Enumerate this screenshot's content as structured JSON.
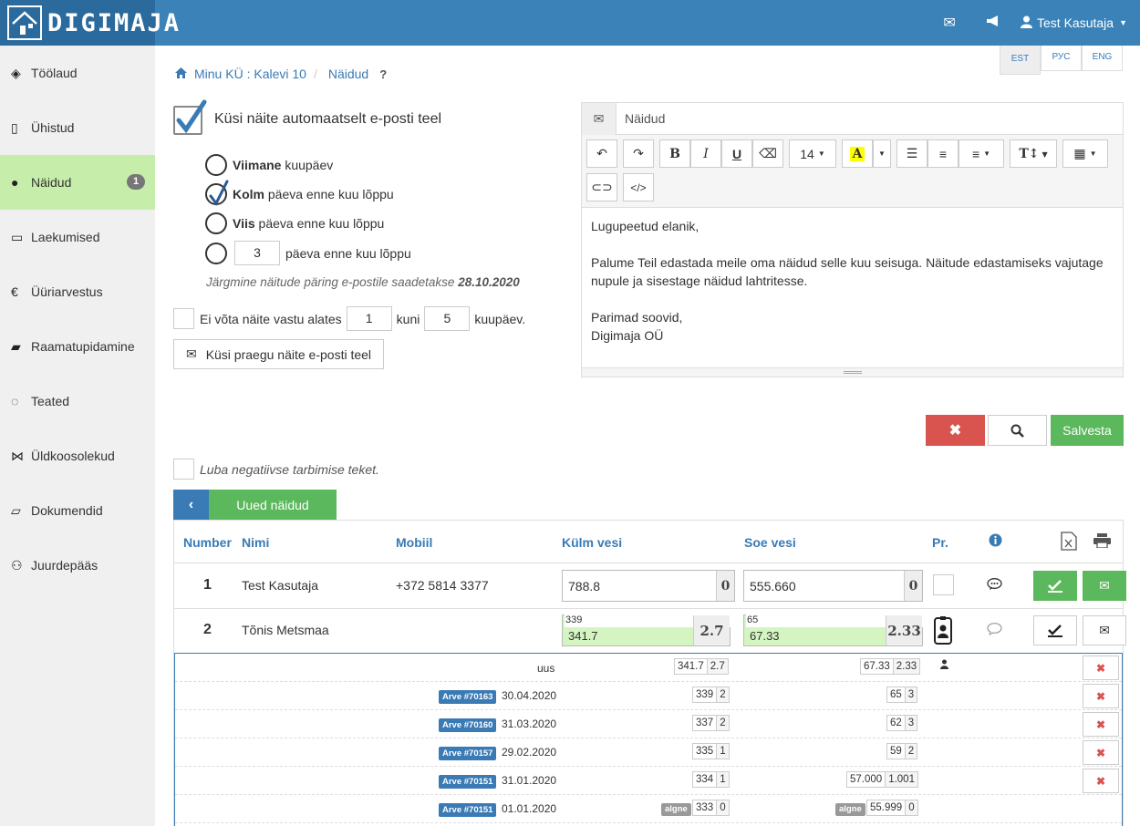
{
  "app": {
    "brand": "DIGIMAJA"
  },
  "topbar": {
    "user": "Test Kasutaja"
  },
  "sidebar": {
    "items": [
      {
        "label": "Töölaud",
        "icon": "cube-icon"
      },
      {
        "label": "Ühistud",
        "icon": "building-icon"
      },
      {
        "label": "Näidud",
        "icon": "drop-icon",
        "badge": "1",
        "active": true
      },
      {
        "label": "Laekumised",
        "icon": "credit-card-icon"
      },
      {
        "label": "Üüriarvestus",
        "icon": "euro-icon"
      },
      {
        "label": "Raamatupidamine",
        "icon": "book-icon"
      },
      {
        "label": "Teated",
        "icon": "chat-icon"
      },
      {
        "label": "Üldkoosolekud",
        "icon": "handshake-icon"
      },
      {
        "label": "Dokumendid",
        "icon": "folder-icon"
      },
      {
        "label": "Juurdepääs",
        "icon": "users-icon"
      }
    ]
  },
  "lang": {
    "est": "EST",
    "rus": "РУС",
    "eng": "ENG"
  },
  "breadcrumb": {
    "home": "Minu KÜ : Kalevi 10",
    "current": "Näidud",
    "help": "?"
  },
  "form": {
    "auto_label": "Küsi näite automaatselt e-posti teel",
    "opt1_bold": "Viimane",
    "opt1_rest": " kuupäev",
    "opt2_bold": "Kolm",
    "opt2_rest": " päeva enne kuu lõppu",
    "opt3_bold": "Viis",
    "opt3_rest": " päeva enne kuu lõppu",
    "opt4_value": "3",
    "opt4_rest": "päeva enne kuu lõppu",
    "next_info": "Järgmine näitude päring e-postile saadetakse",
    "next_date": "28.10.2020",
    "ei_label": "Ei võta näite vastu alates",
    "ei_from": "1",
    "ei_kuni": "kuni",
    "ei_to": "5",
    "ei_suffix": "kuupäev.",
    "ask_now": "Küsi praegu näite e-posti teel",
    "negative_label": "Luba negatiivse tarbimise teket."
  },
  "editor": {
    "subject": "Näidud",
    "font_size": "14",
    "body": {
      "greeting": "Lugupeetud elanik,",
      "line1": "Palume Teil edastada meile oma näidud selle kuu seisuga. Näitude edastamiseks vajutage",
      "line2": "nupule ja sisestage näidud lahtritesse.",
      "closing": "Parimad soovid,",
      "signature": "Digimaja OÜ"
    }
  },
  "actions": {
    "save": "Salvesta"
  },
  "tabs": {
    "new_readings": "Uued näidud"
  },
  "table": {
    "headers": {
      "number": "Number",
      "name": "Nimi",
      "mobile": "Mobiil",
      "cold": "Külm vesi",
      "hot": "Soe vesi",
      "pr": "Pr."
    },
    "rows": [
      {
        "number": "1",
        "name": "Test Kasutaja",
        "mobile": "+372 5814 3377",
        "cold": "788.8",
        "cold_cons": "0",
        "hot": "555.660",
        "hot_cons": "0"
      },
      {
        "number": "2",
        "name": "Tõnis Metsmaa",
        "mobile": "",
        "cold_prev": "339",
        "cold": "341.7",
        "cold_cons": "2.7",
        "hot_prev": "65",
        "hot": "67.33",
        "hot_cons": "2.33"
      }
    ],
    "history": [
      {
        "invoice": "",
        "date": "uus",
        "cold": "341.7",
        "cold_cons": "2.7",
        "hot": "67.33",
        "hot_cons": "2.33"
      },
      {
        "invoice": "Arve #70163",
        "date": "30.04.2020",
        "cold": "339",
        "cold_cons": "2",
        "hot": "65",
        "hot_cons": "3"
      },
      {
        "invoice": "Arve #70160",
        "date": "31.03.2020",
        "cold": "337",
        "cold_cons": "2",
        "hot": "62",
        "hot_cons": "3"
      },
      {
        "invoice": "Arve #70157",
        "date": "29.02.2020",
        "cold": "335",
        "cold_cons": "1",
        "hot": "59",
        "hot_cons": "2"
      },
      {
        "invoice": "Arve #70151",
        "date": "31.01.2020",
        "cold": "334",
        "cold_cons": "1",
        "hot": "57.000",
        "hot_cons": "1.001"
      },
      {
        "invoice": "Arve #70151",
        "date": "01.01.2020",
        "cold": "333",
        "cold_cons": "0",
        "hot": "55.999",
        "hot_cons": "0",
        "tag": "algne"
      }
    ]
  }
}
